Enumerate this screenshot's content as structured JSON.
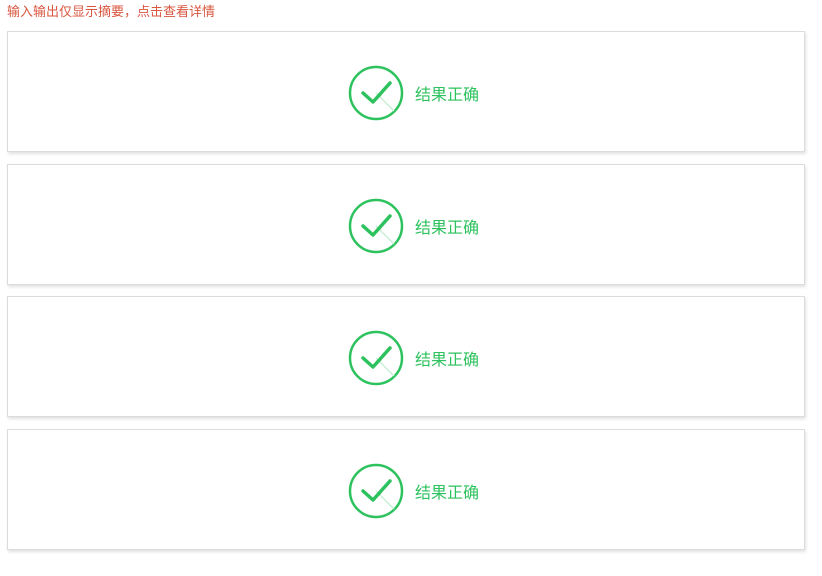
{
  "notice": "输入输出仅显示摘要，点击查看详情",
  "theme": {
    "notice_color": "#d9563f",
    "success_color": "#2ec25e"
  },
  "results": [
    {
      "icon": "check-circle-icon",
      "status": "结果正确"
    },
    {
      "icon": "check-circle-icon",
      "status": "结果正确"
    },
    {
      "icon": "check-circle-icon",
      "status": "结果正确"
    },
    {
      "icon": "check-circle-icon",
      "status": "结果正确"
    }
  ]
}
